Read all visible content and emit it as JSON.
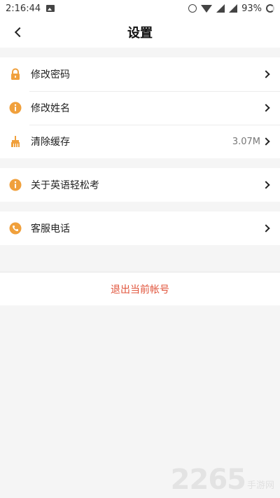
{
  "status_bar": {
    "time": "2:16:44",
    "battery": "93%"
  },
  "header": {
    "title": "设置"
  },
  "groups": [
    {
      "items": [
        {
          "label": "修改密码",
          "icon": "lock-icon"
        },
        {
          "label": "修改姓名",
          "icon": "info-icon"
        },
        {
          "label": "清除缓存",
          "icon": "broom-icon",
          "value": "3.07M"
        }
      ]
    },
    {
      "items": [
        {
          "label": "关于英语轻松考",
          "icon": "info-icon"
        }
      ]
    },
    {
      "items": [
        {
          "label": "客服电话",
          "icon": "phone-icon"
        }
      ]
    }
  ],
  "logout": {
    "label": "退出当前帐号"
  },
  "watermark": {
    "number": "2265",
    "text": "手游网"
  },
  "colors": {
    "accent_orange": "#f0a03c",
    "logout_red": "#e0533a",
    "background": "#f5f5f5"
  }
}
